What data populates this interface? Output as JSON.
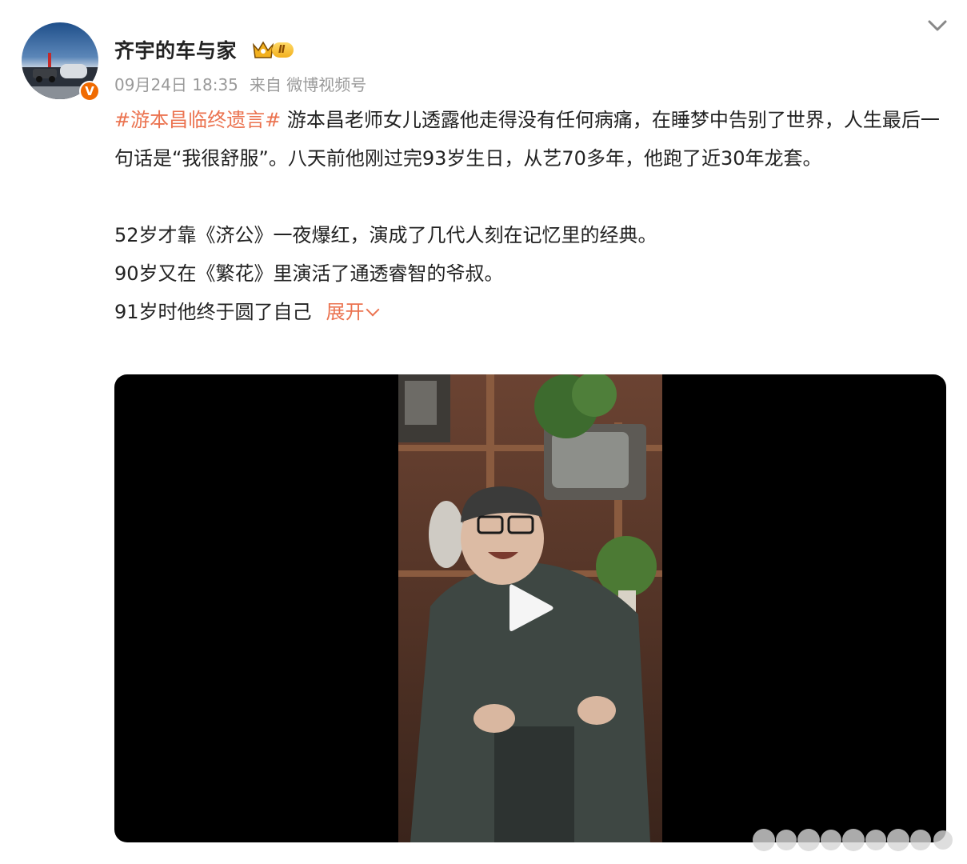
{
  "author": {
    "name": "齐宇的车与家",
    "verified_badge": "V",
    "vip_level": "Ⅱ"
  },
  "meta": {
    "time": "09月24日 18:35",
    "source": "来自 微博视频号"
  },
  "post": {
    "hashtag": "#游本昌临终遗言#",
    "paragraph1": " 游本昌老师女儿透露他走得没有任何病痛，在睡梦中告别了世界，人生最后一句话是“我很舒服”。八天前他刚过完93岁生日，从艺70多年，他跑了近30年龙套。",
    "line2": "52岁才靠《济公》一夜爆红，演成了几代人刻在记忆里的经典。",
    "line3": "90岁又在《繁花》里演活了通透睿智的爷叔。",
    "line4": "91岁时他终于圆了自己",
    "expand_label": "展开"
  },
  "icons": {
    "collapse": "chevron-down-icon",
    "play": "play-icon",
    "crown": "crown-icon"
  },
  "colors": {
    "hashtag": "#eb7350",
    "meta": "#999999",
    "verified": "#f06a00",
    "vip": "#f2b01e"
  }
}
